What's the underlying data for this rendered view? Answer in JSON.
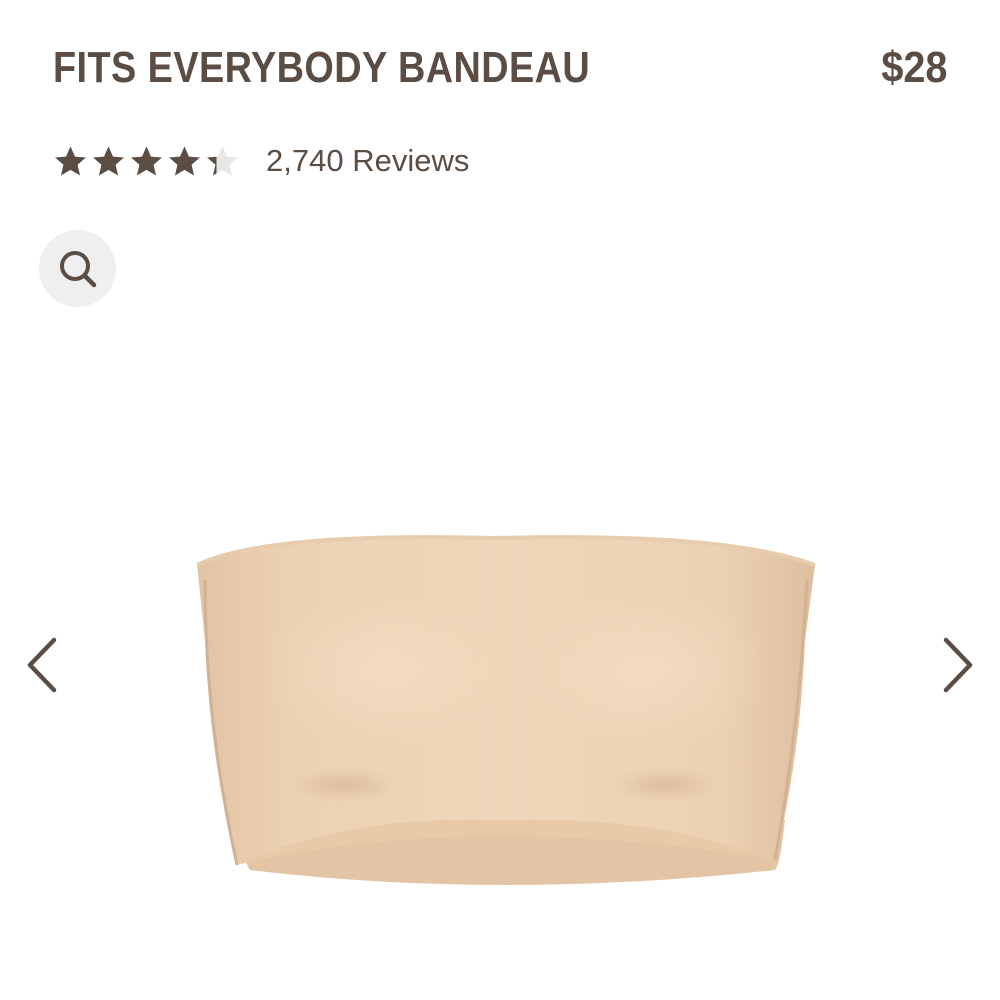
{
  "product": {
    "title": "FITS EVERYBODY BANDEAU",
    "price": "$28"
  },
  "rating": {
    "value": 4.3,
    "max": 5,
    "review_count_label": "2,740 Reviews",
    "star_color": "#5b4d44",
    "empty_star_color": "#e6e6e6"
  },
  "zoom": {
    "icon": "search-icon"
  },
  "carousel": {
    "prev_icon": "chevron-left-icon",
    "next_icon": "chevron-right-icon"
  },
  "colors": {
    "text": "#5b4d44",
    "zoom_bg": "#efefef",
    "garment": "#ecd2b4"
  }
}
